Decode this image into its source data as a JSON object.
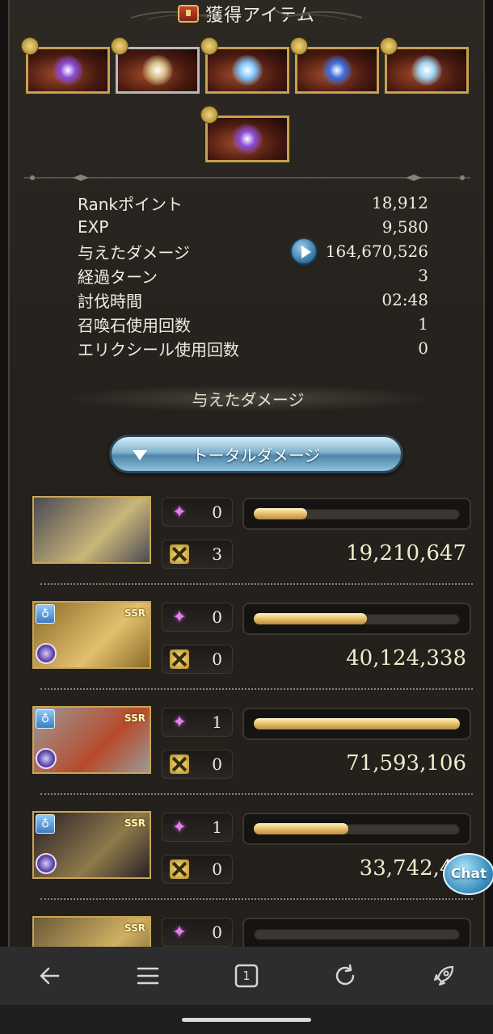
{
  "header": {
    "title": "獲得アイテム",
    "icon": "treasure-chest-icon"
  },
  "items": [
    {
      "name": "dark-shard-item",
      "frame": "gold",
      "glow": "#8b4bd8"
    },
    {
      "name": "scroll-item",
      "frame": "silver",
      "glow": "#d8c08a"
    },
    {
      "name": "crystal-item",
      "frame": "gold",
      "glow": "#7fc8ff"
    },
    {
      "name": "blue-orb-item",
      "frame": "gold",
      "glow": "#3c6fe0"
    },
    {
      "name": "ice-orb-item",
      "frame": "gold",
      "glow": "#9fd4f2"
    },
    {
      "name": "dark-shard-item",
      "frame": "gold",
      "glow": "#8b4bd8"
    }
  ],
  "stats": [
    {
      "label": "Rankポイント",
      "value": "18,912"
    },
    {
      "label": "EXP",
      "value": "9,580"
    },
    {
      "label": "与えたダメージ",
      "value": "164,670,526",
      "has_play": true
    },
    {
      "label": "経過ターン",
      "value": "3"
    },
    {
      "label": "討伐時間",
      "value": "02:48"
    },
    {
      "label": "召喚石使用回数",
      "value": "1"
    },
    {
      "label": "エリクシール使用回数",
      "value": "0"
    }
  ],
  "damage_section": {
    "title": "与えたダメージ",
    "toggle_label": "トータルダメージ"
  },
  "party": [
    {
      "ssr": "",
      "element": "",
      "skills": "0",
      "ougi": "3",
      "damage": "19,210,647",
      "bar": 0.26,
      "art": [
        "#4a4a52",
        "#c9b67a"
      ]
    },
    {
      "ssr": "SSR",
      "element": "♁",
      "skills": "0",
      "ougi": "0",
      "damage": "40,124,338",
      "bar": 0.55,
      "art": [
        "#8a6a2a",
        "#e3c06d"
      ]
    },
    {
      "ssr": "SSR",
      "element": "♁",
      "skills": "1",
      "ougi": "0",
      "damage": "71,593,106",
      "bar": 1.0,
      "art": [
        "#9a9a9a",
        "#b84a2a"
      ]
    },
    {
      "ssr": "SSR",
      "element": "♁",
      "skills": "1",
      "ougi": "0",
      "damage": "33,742,43",
      "bar": 0.46,
      "art": [
        "#2a2028",
        "#8e7a4a"
      ]
    },
    {
      "ssr": "SSR",
      "element": "",
      "skills": "0",
      "ougi": "",
      "damage": "",
      "bar": 0.0,
      "art": [
        "#6a5a3a",
        "#d0b060"
      ]
    }
  ],
  "chat": {
    "label": "Chat"
  },
  "browser_nav": [
    "back-arrow-icon",
    "menu-icon",
    "tab-count-icon",
    "refresh-icon",
    "rocket-icon"
  ],
  "tab_count": "1"
}
